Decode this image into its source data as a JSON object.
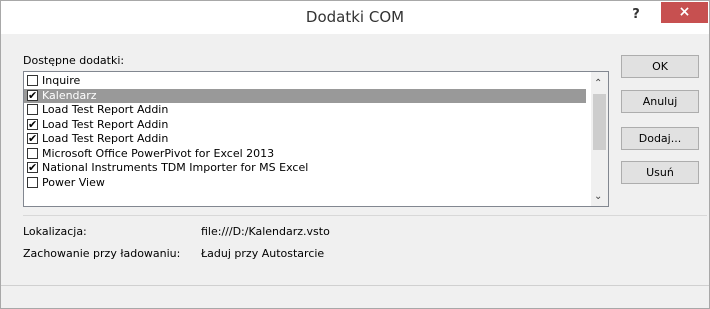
{
  "window": {
    "title": "Dodatki COM",
    "help_label": "?",
    "close_label": "×"
  },
  "addins_label": "Dostępne dodatki:",
  "addins": [
    {
      "label": "Inquire",
      "checked": false,
      "selected": false
    },
    {
      "label": "Kalendarz",
      "checked": true,
      "selected": true
    },
    {
      "label": "Load Test Report Addin",
      "checked": false,
      "selected": false
    },
    {
      "label": "Load Test Report Addin",
      "checked": true,
      "selected": false
    },
    {
      "label": "Load Test Report Addin",
      "checked": true,
      "selected": false
    },
    {
      "label": "Microsoft Office PowerPivot for Excel 2013",
      "checked": false,
      "selected": false
    },
    {
      "label": "National Instruments TDM Importer for MS Excel",
      "checked": true,
      "selected": false
    },
    {
      "label": "Power View",
      "checked": false,
      "selected": false
    }
  ],
  "buttons": {
    "ok": "OK",
    "cancel": "Anuluj",
    "add": "Dodaj...",
    "remove": "Usuń"
  },
  "details": {
    "location_label": "Lokalizacja:",
    "location_value": "file:///D:/Kalendarz.vsto",
    "load_behavior_label": "Zachowanie przy ładowaniu:",
    "load_behavior_value": "Ładuj przy Autostarcie"
  }
}
